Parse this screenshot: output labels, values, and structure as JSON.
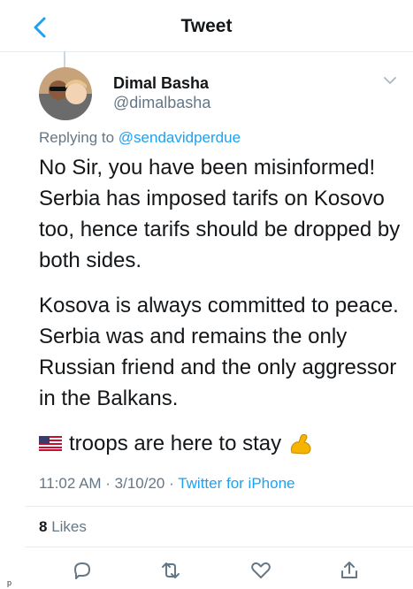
{
  "header": {
    "title": "Tweet"
  },
  "tweet": {
    "author_name": "Dimal Basha",
    "author_handle": "@dimalbasha",
    "replying_prefix": "Replying to",
    "replying_handle": "@sendavidperdue",
    "paragraphs": [
      "No Sir, you have been misinformed! Serbia has imposed tarifs on Kosovo too, hence tarifs should be dropped by both sides.",
      "Kosova is always committed to peace. Serbia was and remains the only Russian friend and the only aggressor in the Balkans.",
      "troops are here to stay"
    ],
    "timestamp": "11:02 AM · 3/10/20 · ",
    "source": "Twitter for iPhone",
    "likes_count": "8",
    "likes_label": "Likes"
  },
  "footer": {
    "char": "p"
  },
  "icons": {
    "back": "chevron-left-icon",
    "options": "chevron-down-icon",
    "reply": "reply-icon",
    "retweet": "retweet-icon",
    "like": "heart-icon",
    "share": "share-icon",
    "flag": "us-flag-emoji",
    "muscle": "flexed-biceps-emoji"
  },
  "colors": {
    "accent": "#1da1f2",
    "secondary": "#657786",
    "text": "#14171a"
  }
}
